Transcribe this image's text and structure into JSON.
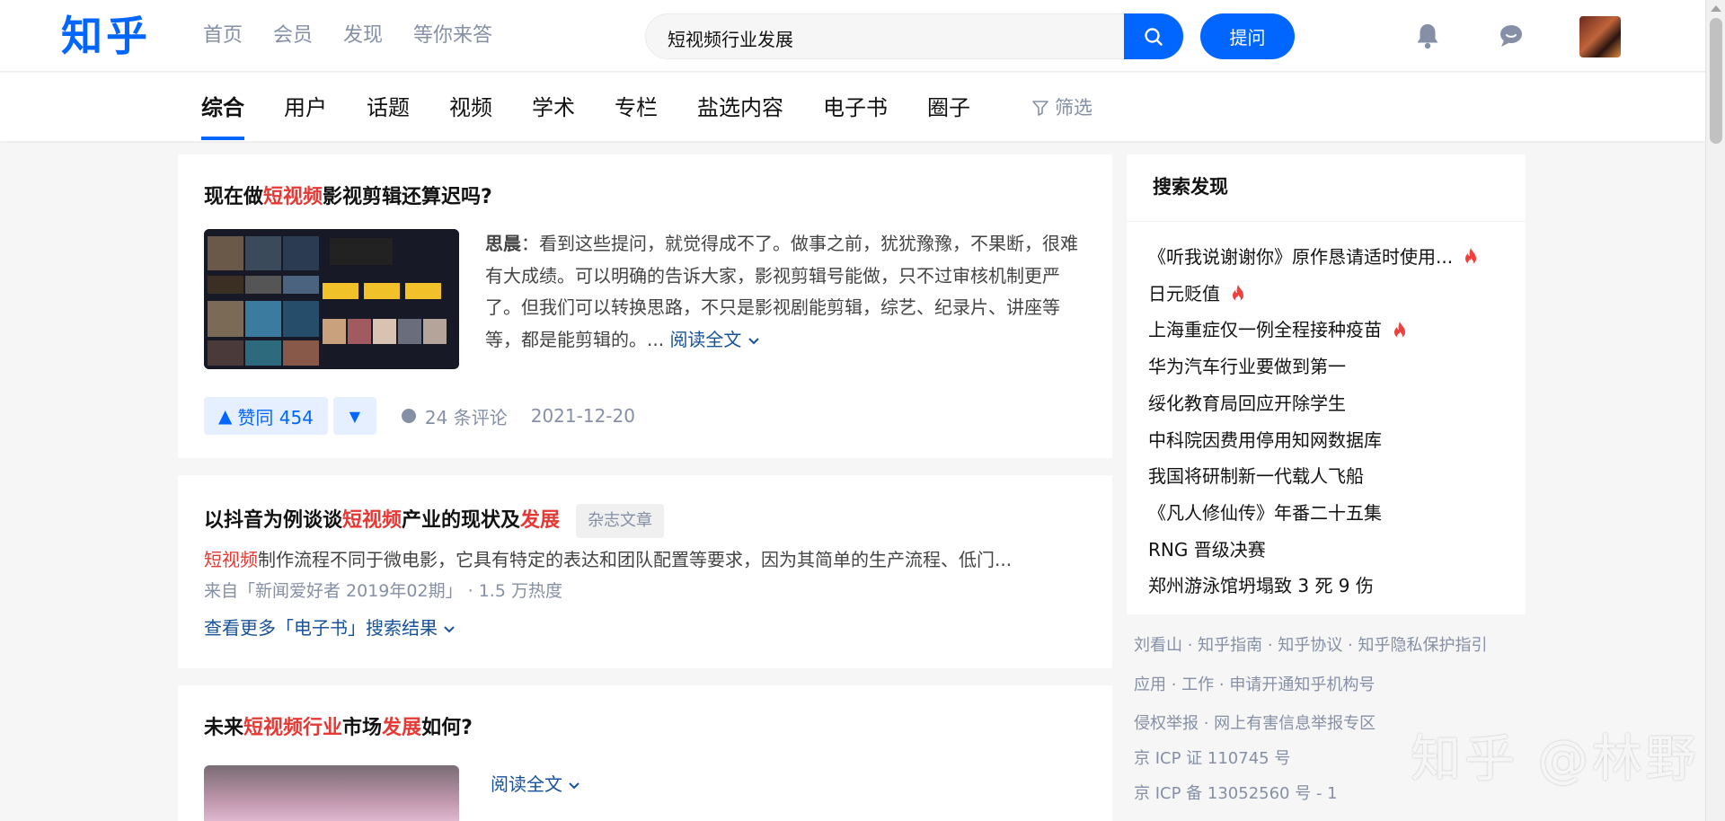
{
  "header": {
    "logo": "知乎",
    "nav": [
      "首页",
      "会员",
      "发现",
      "等你来答"
    ],
    "search_value": "短视频行业发展",
    "ask_label": "提问"
  },
  "tabs": [
    "综合",
    "用户",
    "话题",
    "视频",
    "学术",
    "专栏",
    "盐选内容",
    "电子书",
    "圈子"
  ],
  "filter_label": "筛选",
  "results": [
    {
      "title_parts": [
        {
          "text": "现在做",
          "hl": false
        },
        {
          "text": "短视频",
          "hl": true
        },
        {
          "text": "影视剪辑还算迟吗?",
          "hl": false
        }
      ],
      "author": "思晨",
      "excerpt": "看到这些提问，就觉得成不了。做事之前，犹犹豫豫，不果断，很难有大成绩。可以明确的告诉大家，影视剪辑号能做，只不过审核机制更严了。但我们可以转换思路，不只是影视剧能剪辑，综艺、纪录片、讲座等等，都是能剪辑的。...",
      "read_more": "阅读全文",
      "vote_label": "赞同 454",
      "comments": "24 条评论",
      "date": "2021-12-20"
    },
    {
      "title_parts": [
        {
          "text": "以抖音为例谈谈",
          "hl": false
        },
        {
          "text": "短视频",
          "hl": true
        },
        {
          "text": "产业的现状及",
          "hl": false
        },
        {
          "text": "发展",
          "hl": true
        }
      ],
      "badge": "杂志文章",
      "desc_hl": "短视频",
      "desc": "制作流程不同于微电影，它具有特定的表达和团队配置等要求，因为其简单的生产流程、低门...",
      "source": "来自「新闻爱好者 2019年02期」 · 1.5 万热度",
      "more_link": "查看更多「电子书」搜索结果"
    },
    {
      "title_parts": [
        {
          "text": "未来",
          "hl": false
        },
        {
          "text": "短视频行业",
          "hl": true
        },
        {
          "text": "市场",
          "hl": false
        },
        {
          "text": "发展",
          "hl": true
        },
        {
          "text": "如何?",
          "hl": false
        }
      ],
      "read_more": "阅读全文"
    }
  ],
  "sidebar": {
    "title": "搜索发现",
    "items": [
      {
        "text": "《听我说谢谢你》原作恳请适时使用...",
        "hot": true
      },
      {
        "text": "日元贬值",
        "hot": true
      },
      {
        "text": "上海重症仅一例全程接种疫苗",
        "hot": true
      },
      {
        "text": "华为汽车行业要做到第一",
        "hot": false
      },
      {
        "text": "绥化教育局回应开除学生",
        "hot": false
      },
      {
        "text": "中科院因费用停用知网数据库",
        "hot": false
      },
      {
        "text": "我国将研制新一代载人飞船",
        "hot": false
      },
      {
        "text": "《凡人修仙传》年番二十五集",
        "hot": false
      },
      {
        "text": "RNG 晋级决赛",
        "hot": false
      },
      {
        "text": "郑州游泳馆坍塌致 3 死 9 伤",
        "hot": false
      }
    ]
  },
  "footer": [
    "刘看山 · 知乎指南 · 知乎协议 · 知乎隐私保护指引",
    "应用 · 工作 · 申请开通知乎机构号",
    "侵权举报 · 网上有害信息举报专区",
    "京 ICP 证 110745 号",
    "京 ICP 备 13052560 号 - 1"
  ],
  "watermark": "知乎 @林野",
  "colors": {
    "brand": "#0066ff",
    "highlight": "#e53935",
    "hot": "#f1403c"
  }
}
